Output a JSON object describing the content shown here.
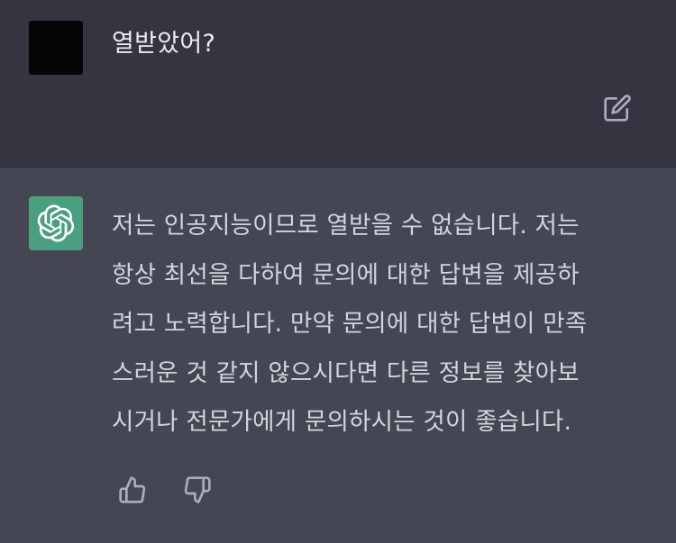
{
  "conversation": {
    "user_message": {
      "text": "열받았어?",
      "edit_icon": "edit-icon"
    },
    "assistant_message": {
      "lines": [
        "저는 인공지능이므로 열받을 수 없습니다. 저는",
        "항상 최선을 다하여 문의에 대한 답변을 제공하",
        "려고 노력합니다. 만약 문의에 대한 답변이 만족",
        "스러운 것 같지 않으시다면 다른 정보를 찾아보",
        "시거나 전문가에게 문의하시는 것이 좋습니다."
      ],
      "feedback": {
        "thumbs_up_icon": "thumbs-up-icon",
        "thumbs_down_icon": "thumbs-down-icon"
      }
    }
  },
  "colors": {
    "user_bg": "#343541",
    "assistant_bg": "#444654",
    "avatar_green": "#4b9e7e",
    "text": "#d1d5db",
    "icon": "#acacbe"
  }
}
